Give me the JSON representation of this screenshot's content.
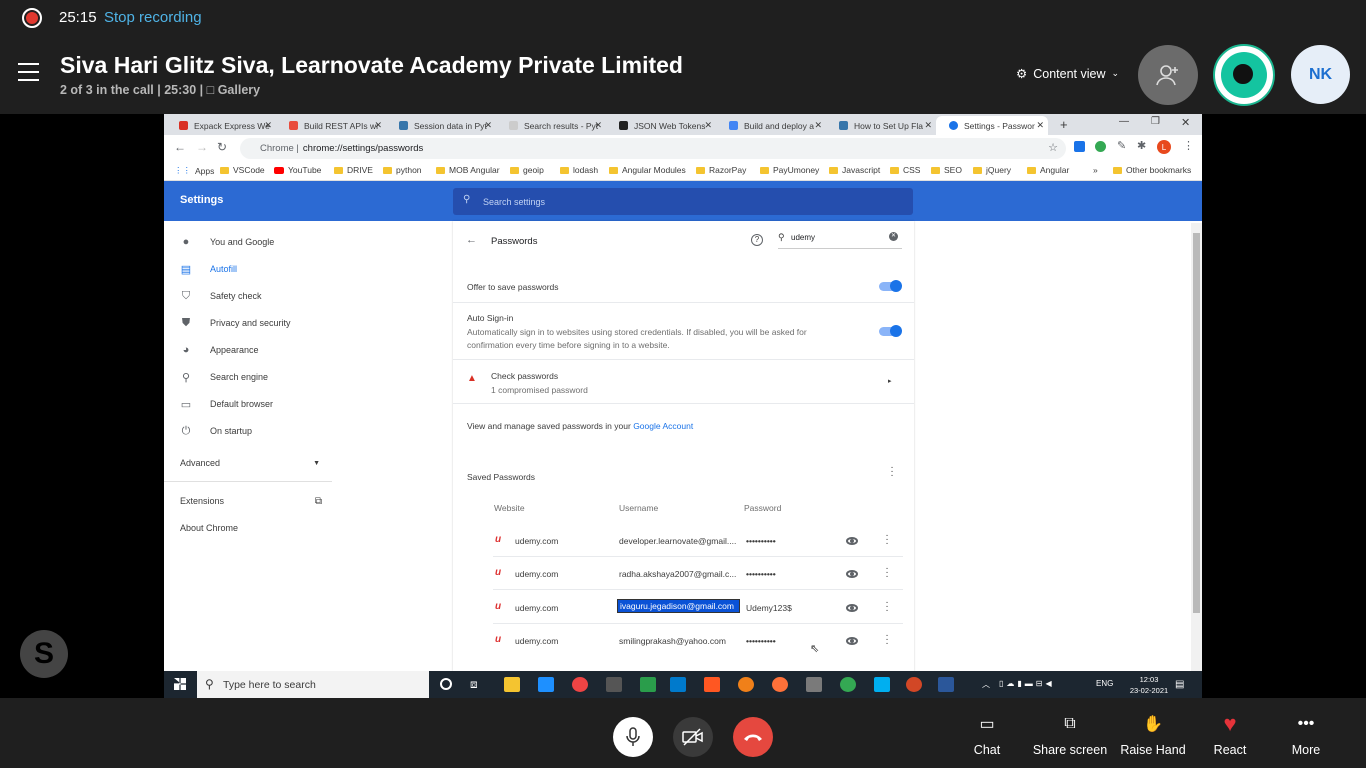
{
  "recording": {
    "time": "25:15",
    "stop_label": "Stop recording"
  },
  "call": {
    "title": "Siva Hari Glitz Siva, Learnovate Academy Private Limited",
    "subtitle": "2 of 3 in the call | 25:30 |",
    "gallery_label": "Gallery",
    "content_view_label": "Content view",
    "participant_initials": "NK"
  },
  "browser": {
    "tabs": [
      "Expack Express We",
      "Build REST APIs wi",
      "Session data in Pyt",
      "Search results - Pyt",
      "JSON Web Tokens",
      "Build and deploy a",
      "How to Set Up Fla",
      "Settings - Passwor"
    ],
    "url_prefix": "Chrome |",
    "url": "chrome://settings/passwords",
    "profile_initial": "L",
    "bookmarks": [
      "Apps",
      "VSCode",
      "YouTube",
      "DRIVE",
      "python",
      "MOB Angular",
      "geoip",
      "lodash",
      "Angular Modules",
      "RazorPay",
      "PayUmoney",
      "Javascript",
      "CSS",
      "SEO",
      "jQuery",
      "Angular"
    ],
    "bookmarks_overflow": "»",
    "other_bookmarks": "Other bookmarks"
  },
  "settings": {
    "title": "Settings",
    "search_placeholder": "Search settings",
    "nav": [
      "You and Google",
      "Autofill",
      "Safety check",
      "Privacy and security",
      "Appearance",
      "Search engine",
      "Default browser",
      "On startup"
    ],
    "advanced_label": "Advanced",
    "extensions_label": "Extensions",
    "about_label": "About Chrome"
  },
  "passwords": {
    "page_title": "Passwords",
    "filter_value": "udemy",
    "offer_save_label": "Offer to save passwords",
    "auto_signin_label": "Auto Sign-in",
    "auto_signin_desc_1": "Automatically sign in to websites using stored credentials. If disabled, you will be asked for",
    "auto_signin_desc_2": "confirmation every time before signing in to a website.",
    "check_title": "Check passwords",
    "check_sub": "1 compromised password",
    "manage_text": "View and manage saved passwords in your",
    "google_account_link": "Google Account",
    "saved_heading": "Saved Passwords",
    "col_website": "Website",
    "col_username": "Username",
    "col_password": "Password",
    "rows": [
      {
        "site": "udemy.com",
        "user": "developer.learnovate@gmail....",
        "pass": "••••••••••"
      },
      {
        "site": "udemy.com",
        "user": "radha.akshaya2007@gmail.c...",
        "pass": "••••••••••"
      },
      {
        "site": "udemy.com",
        "user": "ivaguru.jegadison@gmail.com",
        "pass": "Udemy123$"
      },
      {
        "site": "udemy.com",
        "user": "smilingprakash@yahoo.com",
        "pass": "••••••••••"
      }
    ]
  },
  "taskbar": {
    "search_placeholder": "Type here to search",
    "lang": "ENG",
    "time": "12:03",
    "date": "23-02-2021"
  },
  "controls": {
    "chat": "Chat",
    "share": "Share screen",
    "raise": "Raise Hand",
    "react": "React",
    "more": "More"
  },
  "colors": {
    "accent": "#2c6ad3",
    "record": "#e0382f",
    "hangup": "#e5483f",
    "link": "#4fb3e6"
  }
}
